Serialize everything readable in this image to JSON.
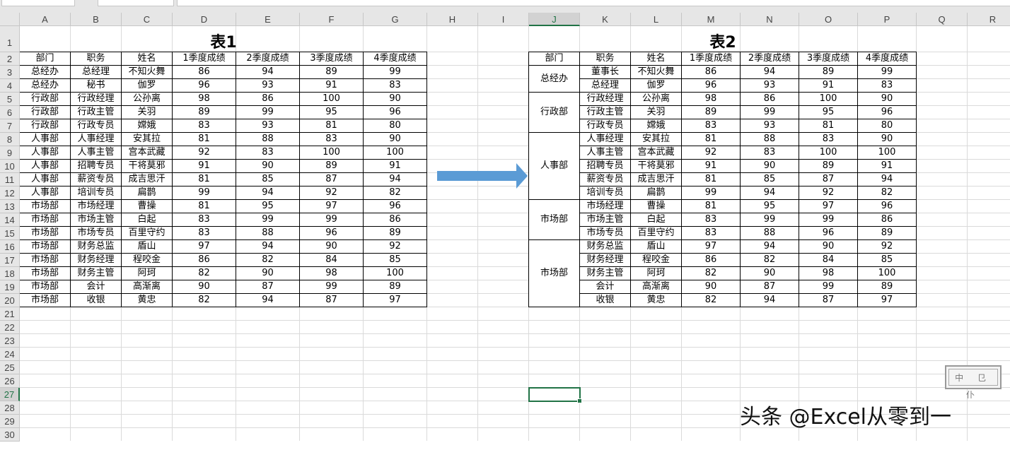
{
  "columns": [
    "A",
    "B",
    "C",
    "D",
    "E",
    "F",
    "G",
    "H",
    "I",
    "J",
    "K",
    "L",
    "M",
    "N",
    "O",
    "P",
    "Q",
    "R"
  ],
  "rows": [
    "1",
    "2",
    "3",
    "4",
    "5",
    "6",
    "7",
    "8",
    "9",
    "10",
    "11",
    "12",
    "13",
    "14",
    "15",
    "16",
    "17",
    "18",
    "19",
    "20",
    "21",
    "22",
    "23",
    "24",
    "25",
    "26",
    "27",
    "28",
    "29",
    "30"
  ],
  "active_column": "J",
  "active_row": "27",
  "table1": {
    "title": "表1",
    "headers": [
      "部门",
      "职务",
      "姓名",
      "1季度成绩",
      "2季度成绩",
      "3季度成绩",
      "4季度成绩"
    ],
    "rows": [
      [
        "总经办",
        "总经理",
        "不知火舞",
        "86",
        "94",
        "89",
        "99"
      ],
      [
        "总经办",
        "秘书",
        "伽罗",
        "96",
        "93",
        "91",
        "83"
      ],
      [
        "行政部",
        "行政经理",
        "公孙离",
        "98",
        "86",
        "100",
        "90"
      ],
      [
        "行政部",
        "行政主管",
        "关羽",
        "89",
        "99",
        "95",
        "96"
      ],
      [
        "行政部",
        "行政专员",
        "嫦娥",
        "83",
        "93",
        "81",
        "80"
      ],
      [
        "人事部",
        "人事经理",
        "安其拉",
        "81",
        "88",
        "83",
        "90"
      ],
      [
        "人事部",
        "人事主管",
        "宫本武藏",
        "92",
        "83",
        "100",
        "100"
      ],
      [
        "人事部",
        "招聘专员",
        "干将莫邪",
        "91",
        "90",
        "89",
        "91"
      ],
      [
        "人事部",
        "薪资专员",
        "成吉思汗",
        "81",
        "85",
        "87",
        "94"
      ],
      [
        "人事部",
        "培训专员",
        "扁鹊",
        "99",
        "94",
        "92",
        "82"
      ],
      [
        "市场部",
        "市场经理",
        "曹操",
        "81",
        "95",
        "97",
        "96"
      ],
      [
        "市场部",
        "市场主管",
        "白起",
        "83",
        "99",
        "99",
        "86"
      ],
      [
        "市场部",
        "市场专员",
        "百里守约",
        "83",
        "88",
        "96",
        "89"
      ],
      [
        "市场部",
        "财务总监",
        "盾山",
        "97",
        "94",
        "90",
        "92"
      ],
      [
        "市场部",
        "财务经理",
        "程咬金",
        "86",
        "82",
        "84",
        "85"
      ],
      [
        "市场部",
        "财务主管",
        "阿珂",
        "82",
        "90",
        "98",
        "100"
      ],
      [
        "市场部",
        "会计",
        "高渐离",
        "90",
        "87",
        "99",
        "89"
      ],
      [
        "市场部",
        "收银",
        "黄忠",
        "82",
        "94",
        "87",
        "97"
      ]
    ]
  },
  "table2": {
    "title": "表2",
    "headers": [
      "部门",
      "职务",
      "姓名",
      "1季度成绩",
      "2季度成绩",
      "3季度成绩",
      "4季度成绩"
    ],
    "groups": [
      {
        "dept": "总经办",
        "span": 2
      },
      {
        "dept": "行政部",
        "span": 3
      },
      {
        "dept": "人事部",
        "span": 5
      },
      {
        "dept": "市场部",
        "span": 3
      },
      {
        "dept": "市场部",
        "span": 5
      }
    ],
    "rows": [
      [
        "董事长",
        "不知火舞",
        "86",
        "94",
        "89",
        "99"
      ],
      [
        "总经理",
        "伽罗",
        "96",
        "93",
        "91",
        "83"
      ],
      [
        "行政经理",
        "公孙离",
        "98",
        "86",
        "100",
        "90"
      ],
      [
        "行政主管",
        "关羽",
        "89",
        "99",
        "95",
        "96"
      ],
      [
        "行政专员",
        "嫦娥",
        "83",
        "93",
        "81",
        "80"
      ],
      [
        "人事经理",
        "安其拉",
        "81",
        "88",
        "83",
        "90"
      ],
      [
        "人事主管",
        "宫本武藏",
        "92",
        "83",
        "100",
        "100"
      ],
      [
        "招聘专员",
        "干将莫邪",
        "91",
        "90",
        "89",
        "91"
      ],
      [
        "薪资专员",
        "成吉思汗",
        "81",
        "85",
        "87",
        "94"
      ],
      [
        "培训专员",
        "扁鹊",
        "99",
        "94",
        "92",
        "82"
      ],
      [
        "市场经理",
        "曹操",
        "81",
        "95",
        "97",
        "96"
      ],
      [
        "市场主管",
        "白起",
        "83",
        "99",
        "99",
        "86"
      ],
      [
        "市场专员",
        "百里守约",
        "83",
        "88",
        "96",
        "89"
      ],
      [
        "财务总监",
        "盾山",
        "97",
        "94",
        "90",
        "92"
      ],
      [
        "财务经理",
        "程咬金",
        "86",
        "82",
        "84",
        "85"
      ],
      [
        "财务主管",
        "阿珂",
        "82",
        "90",
        "98",
        "100"
      ],
      [
        "会计",
        "高渐离",
        "90",
        "87",
        "99",
        "89"
      ],
      [
        "收银",
        "黄忠",
        "82",
        "94",
        "87",
        "97"
      ]
    ]
  },
  "arrow": {
    "color": "#5b9bd5",
    "icon": "right-arrow-shape"
  },
  "seal_text": "中 ⺋ 仆",
  "watermark": "头条 @Excel从零到一",
  "colors": {
    "gridline": "#dadada",
    "header_bg": "#e6e6e6",
    "selection": "#217346"
  }
}
